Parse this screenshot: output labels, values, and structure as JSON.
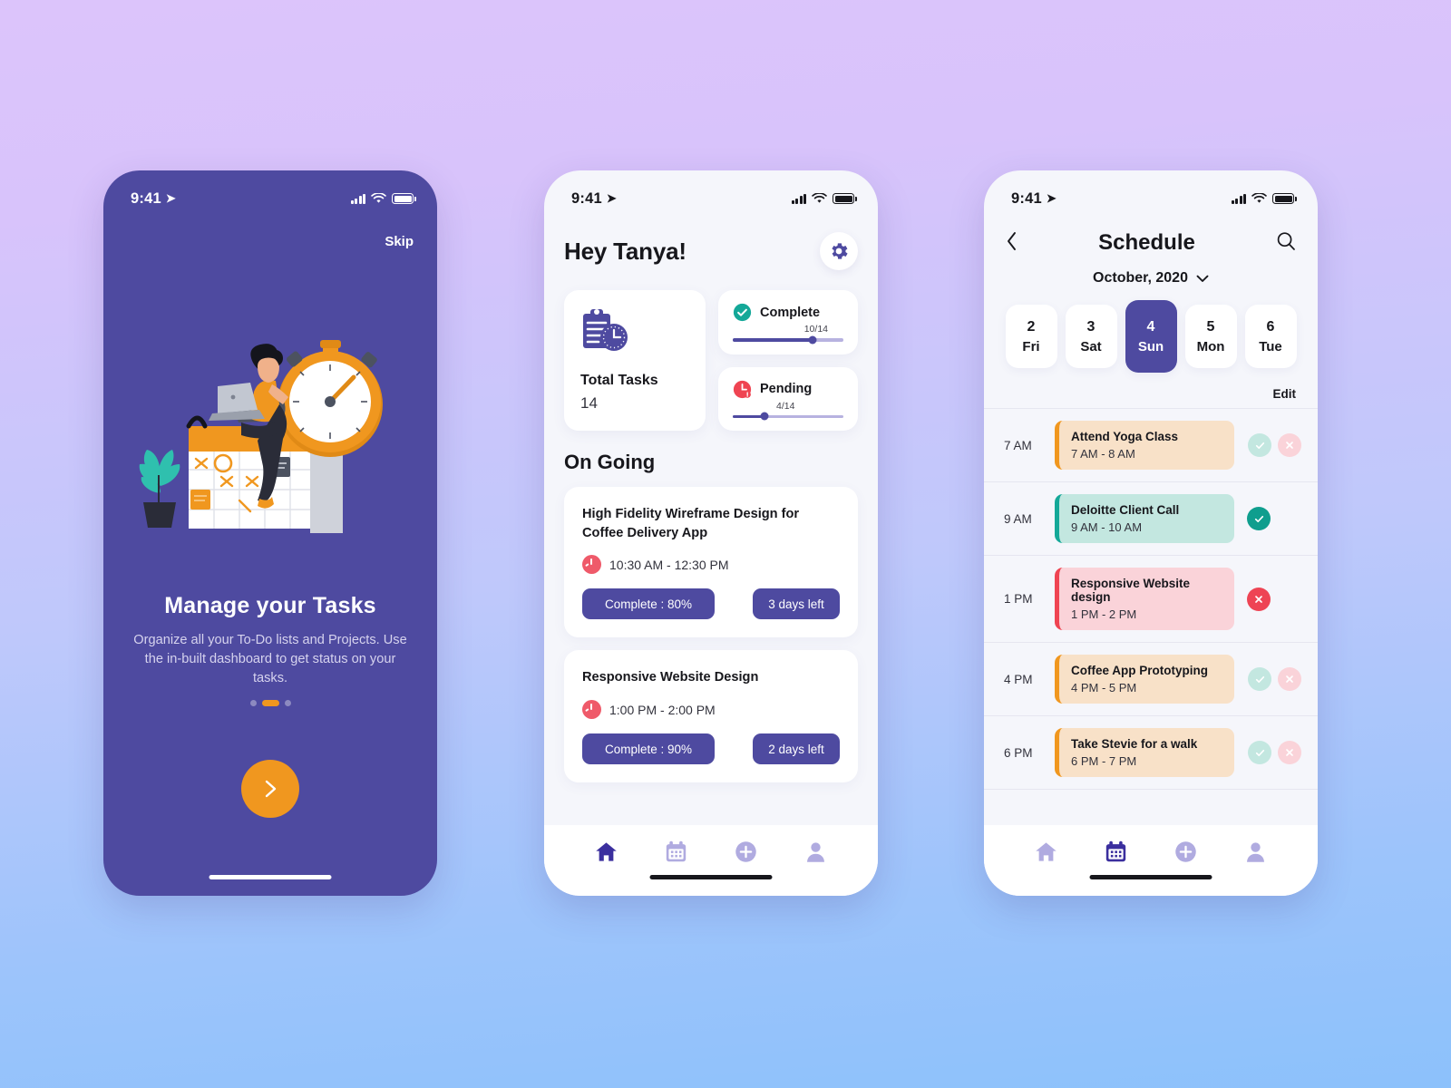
{
  "background": {
    "gradient_top": "#dcc4fb",
    "gradient_bottom": "#8cc1fb"
  },
  "colors": {
    "primary_purple": "#4e4aa0",
    "orange": "#f0971f",
    "teal": "#14a898",
    "red": "#ef4452",
    "pink_block": "#fad3d9",
    "peach_block": "#f8e1c8",
    "mint_block": "#c3e7e0"
  },
  "onboarding": {
    "status_bar": {
      "time": "9:41",
      "location_icon": "location-arrow-icon",
      "signal_icon": "cellular-bars-icon",
      "wifi_icon": "wifi-icon",
      "battery_icon": "battery-icon"
    },
    "skip_label": "Skip",
    "illustration_name": "woman-on-calendar-with-stopwatch-illustration",
    "title": "Manage your Tasks",
    "subtitle": "Organize all your To-Do lists and Projects. Use the in-built dashboard to get status on your tasks.",
    "pager": {
      "total": 3,
      "active_index": 1
    },
    "next_button_icon": "chevron-right-icon"
  },
  "dashboard": {
    "status_bar": {
      "time": "9:41"
    },
    "greeting": "Hey Tanya!",
    "settings_icon": "gear-icon",
    "total_tasks": {
      "icon": "clipboard-clock-icon",
      "label": "Total Tasks",
      "value": "14"
    },
    "complete": {
      "icon": "check-circle-icon",
      "label": "Complete",
      "ratio": "10/14",
      "percent": 71
    },
    "pending": {
      "icon": "clock-alert-icon",
      "label": "Pending",
      "ratio": "4/14",
      "percent": 29
    },
    "section_title": "On Going",
    "tasks": [
      {
        "name": "High Fidelity Wireframe Design for Coffee Delivery App",
        "time_icon": "clock-icon",
        "time": "10:30 AM - 12:30 PM",
        "complete_label": "Complete : 80%",
        "days_left_label": "3 days left"
      },
      {
        "name": "Responsive Website Design",
        "time_icon": "clock-icon",
        "time": "1:00 PM - 2:00 PM",
        "complete_label": "Complete : 90%",
        "days_left_label": "2 days left"
      }
    ],
    "nav": [
      {
        "icon": "home-icon",
        "active": true
      },
      {
        "icon": "calendar-icon",
        "active": false
      },
      {
        "icon": "plus-circle-icon",
        "active": false
      },
      {
        "icon": "user-icon",
        "active": false
      }
    ]
  },
  "schedule": {
    "status_bar": {
      "time": "9:41"
    },
    "back_icon": "chevron-left-icon",
    "title": "Schedule",
    "search_icon": "search-icon",
    "month": "October, 2020",
    "month_chevron_icon": "chevron-down-icon",
    "days": [
      {
        "num": "2",
        "dow": "Fri",
        "selected": false
      },
      {
        "num": "3",
        "dow": "Sat",
        "selected": false
      },
      {
        "num": "4",
        "dow": "Sun",
        "selected": true
      },
      {
        "num": "5",
        "dow": "Mon",
        "selected": false
      },
      {
        "num": "6",
        "dow": "Tue",
        "selected": false
      }
    ],
    "edit_label": "Edit",
    "events": [
      {
        "hour": "7 AM",
        "name": "Attend Yoga Class",
        "range": "7 AM - 8 AM",
        "bg": "#f8e1c8",
        "accent": "#f0971f",
        "state": "idle"
      },
      {
        "hour": "9 AM",
        "name": "Deloitte Client Call",
        "range": "9 AM - 10 AM",
        "bg": "#c3e7e0",
        "accent": "#14a898",
        "state": "accepted"
      },
      {
        "hour": "1 PM",
        "name": "Responsive Website design",
        "range": "1 PM - 2 PM",
        "bg": "#fad3d9",
        "accent": "#ef4452",
        "state": "rejected"
      },
      {
        "hour": "4 PM",
        "name": "Coffee App Prototyping",
        "range": "4 PM - 5 PM",
        "bg": "#f8e1c8",
        "accent": "#f0971f",
        "state": "idle"
      },
      {
        "hour": "6 PM",
        "name": "Take Stevie for a walk",
        "range": "6 PM - 7 PM",
        "bg": "#f8e1c8",
        "accent": "#f0971f",
        "state": "idle"
      }
    ],
    "nav": [
      {
        "icon": "home-icon",
        "active": false
      },
      {
        "icon": "calendar-icon",
        "active": true
      },
      {
        "icon": "plus-circle-icon",
        "active": false
      },
      {
        "icon": "user-icon",
        "active": false
      }
    ]
  }
}
